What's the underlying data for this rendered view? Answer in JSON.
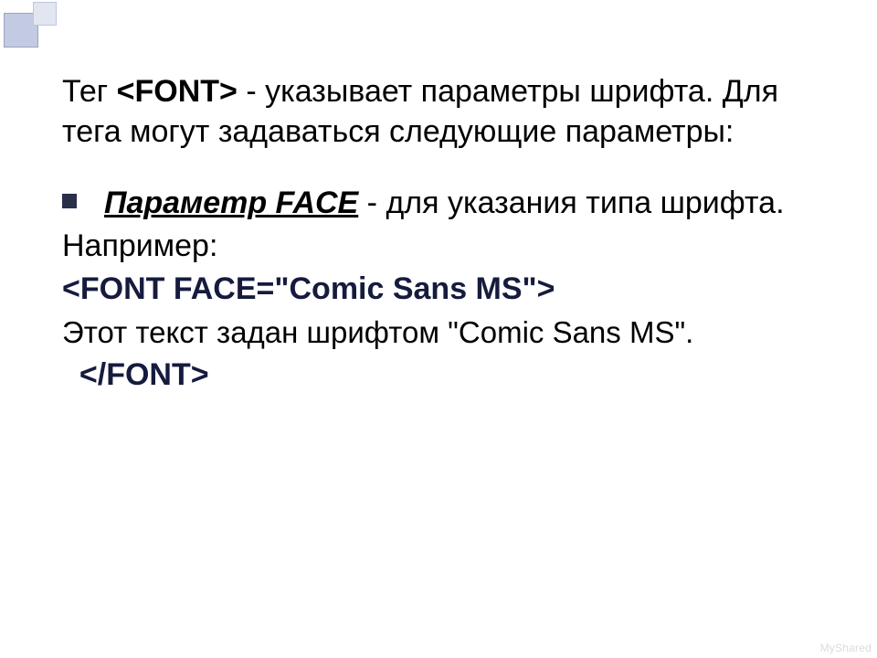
{
  "para1": {
    "prefix": "Тег ",
    "tag": "<FONT>",
    "rest": " - указывает параметры шрифта. Для тега могут задаваться следующие параметры:"
  },
  "bullet": {
    "face_label": "Параметр FACE",
    "face_rest": " - для указания типа шрифта."
  },
  "example_label": "Например:",
  "code_open": "<FONT FACE=\"Comic Sans MS\">",
  "comic_text": "Этот текст задан шрифтом \"Comic Sans MS\".",
  "code_close": "</FONT>",
  "watermark": "MyShared"
}
